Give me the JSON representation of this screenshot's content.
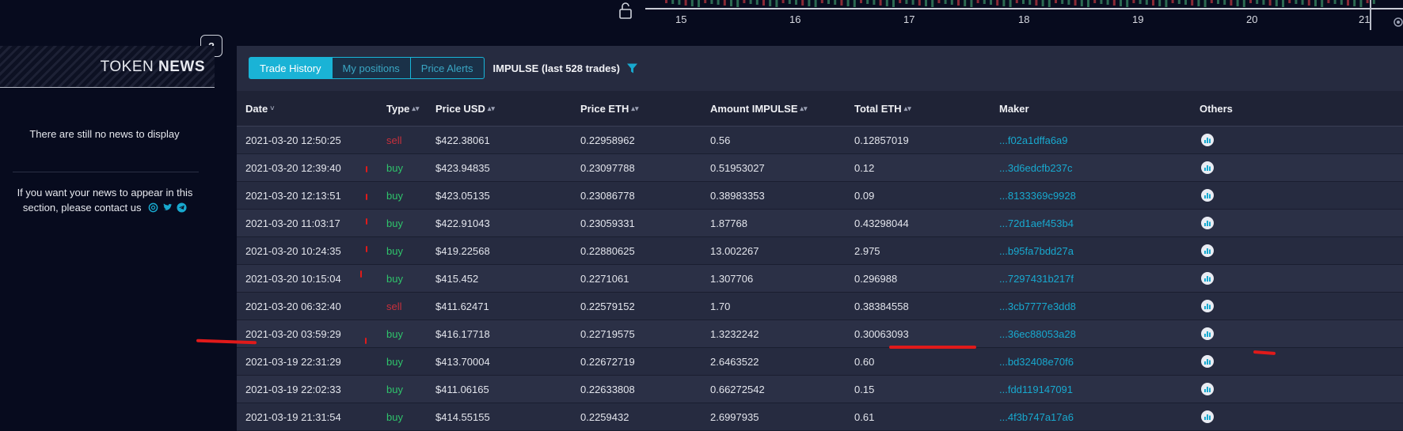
{
  "chart": {
    "x_ticks": [
      "15",
      "16",
      "17",
      "18",
      "19",
      "20",
      "21"
    ]
  },
  "news": {
    "help_label": "?",
    "title_light": "TOKEN ",
    "title_bold": "NEWS",
    "empty_text": "There are still no news to display",
    "contact_text": "If you want your news to appear in this section, please contact us"
  },
  "toolbar": {
    "tabs": [
      "Trade History",
      "My positions",
      "Price Alerts"
    ],
    "trades_label": "IMPULSE (last 528 trades)"
  },
  "table": {
    "headers": [
      "Date",
      "Type",
      "Price USD",
      "Price ETH",
      "Amount IMPULSE",
      "Total ETH",
      "Maker",
      "Others"
    ],
    "rows": [
      [
        "2021-03-20 12:50:25",
        "sell",
        "$422.38061",
        "0.22958962",
        "0.56",
        "0.12857019",
        "...f02a1dffa6a9"
      ],
      [
        "2021-03-20 12:39:40",
        "buy",
        "$423.94835",
        "0.23097788",
        "0.51953027",
        "0.12",
        "...3d6edcfb237c"
      ],
      [
        "2021-03-20 12:13:51",
        "buy",
        "$423.05135",
        "0.23086778",
        "0.38983353",
        "0.09",
        "...8133369c9928"
      ],
      [
        "2021-03-20 11:03:17",
        "buy",
        "$422.91043",
        "0.23059331",
        "1.87768",
        "0.43298044",
        "...72d1aef453b4"
      ],
      [
        "2021-03-20 10:24:35",
        "buy",
        "$419.22568",
        "0.22880625",
        "13.002267",
        "2.975",
        "...b95fa7bdd27a"
      ],
      [
        "2021-03-20 10:15:04",
        "buy",
        "$415.452",
        "0.2271061",
        "1.307706",
        "0.296988",
        "...7297431b217f"
      ],
      [
        "2021-03-20 06:32:40",
        "sell",
        "$411.62471",
        "0.22579152",
        "1.70",
        "0.38384558",
        "...3cb7777e3dd8"
      ],
      [
        "2021-03-20 03:59:29",
        "buy",
        "$416.17718",
        "0.22719575",
        "1.3232242",
        "0.30063093",
        "...36ec88053a28"
      ],
      [
        "2021-03-19 22:31:29",
        "buy",
        "$413.70004",
        "0.22672719",
        "2.6463522",
        "0.60",
        "...bd32408e70f6"
      ],
      [
        "2021-03-19 22:02:33",
        "buy",
        "$411.06165",
        "0.22633808",
        "0.66272542",
        "0.15",
        "...fdd119147091"
      ],
      [
        "2021-03-19 21:31:54",
        "buy",
        "$414.55155",
        "0.2259432",
        "2.6997935",
        "0.61",
        "...4f3b747a17a6"
      ]
    ]
  },
  "colors": {
    "background": "#070b1e",
    "panel": "#262b40",
    "accent": "#1ab3d6",
    "buy": "#2fc36b",
    "sell": "#c8303c"
  },
  "icons": [
    "lock-icon",
    "gear-icon",
    "filter-icon",
    "email-icon",
    "twitter-icon",
    "telegram-icon",
    "chart-icon"
  ]
}
